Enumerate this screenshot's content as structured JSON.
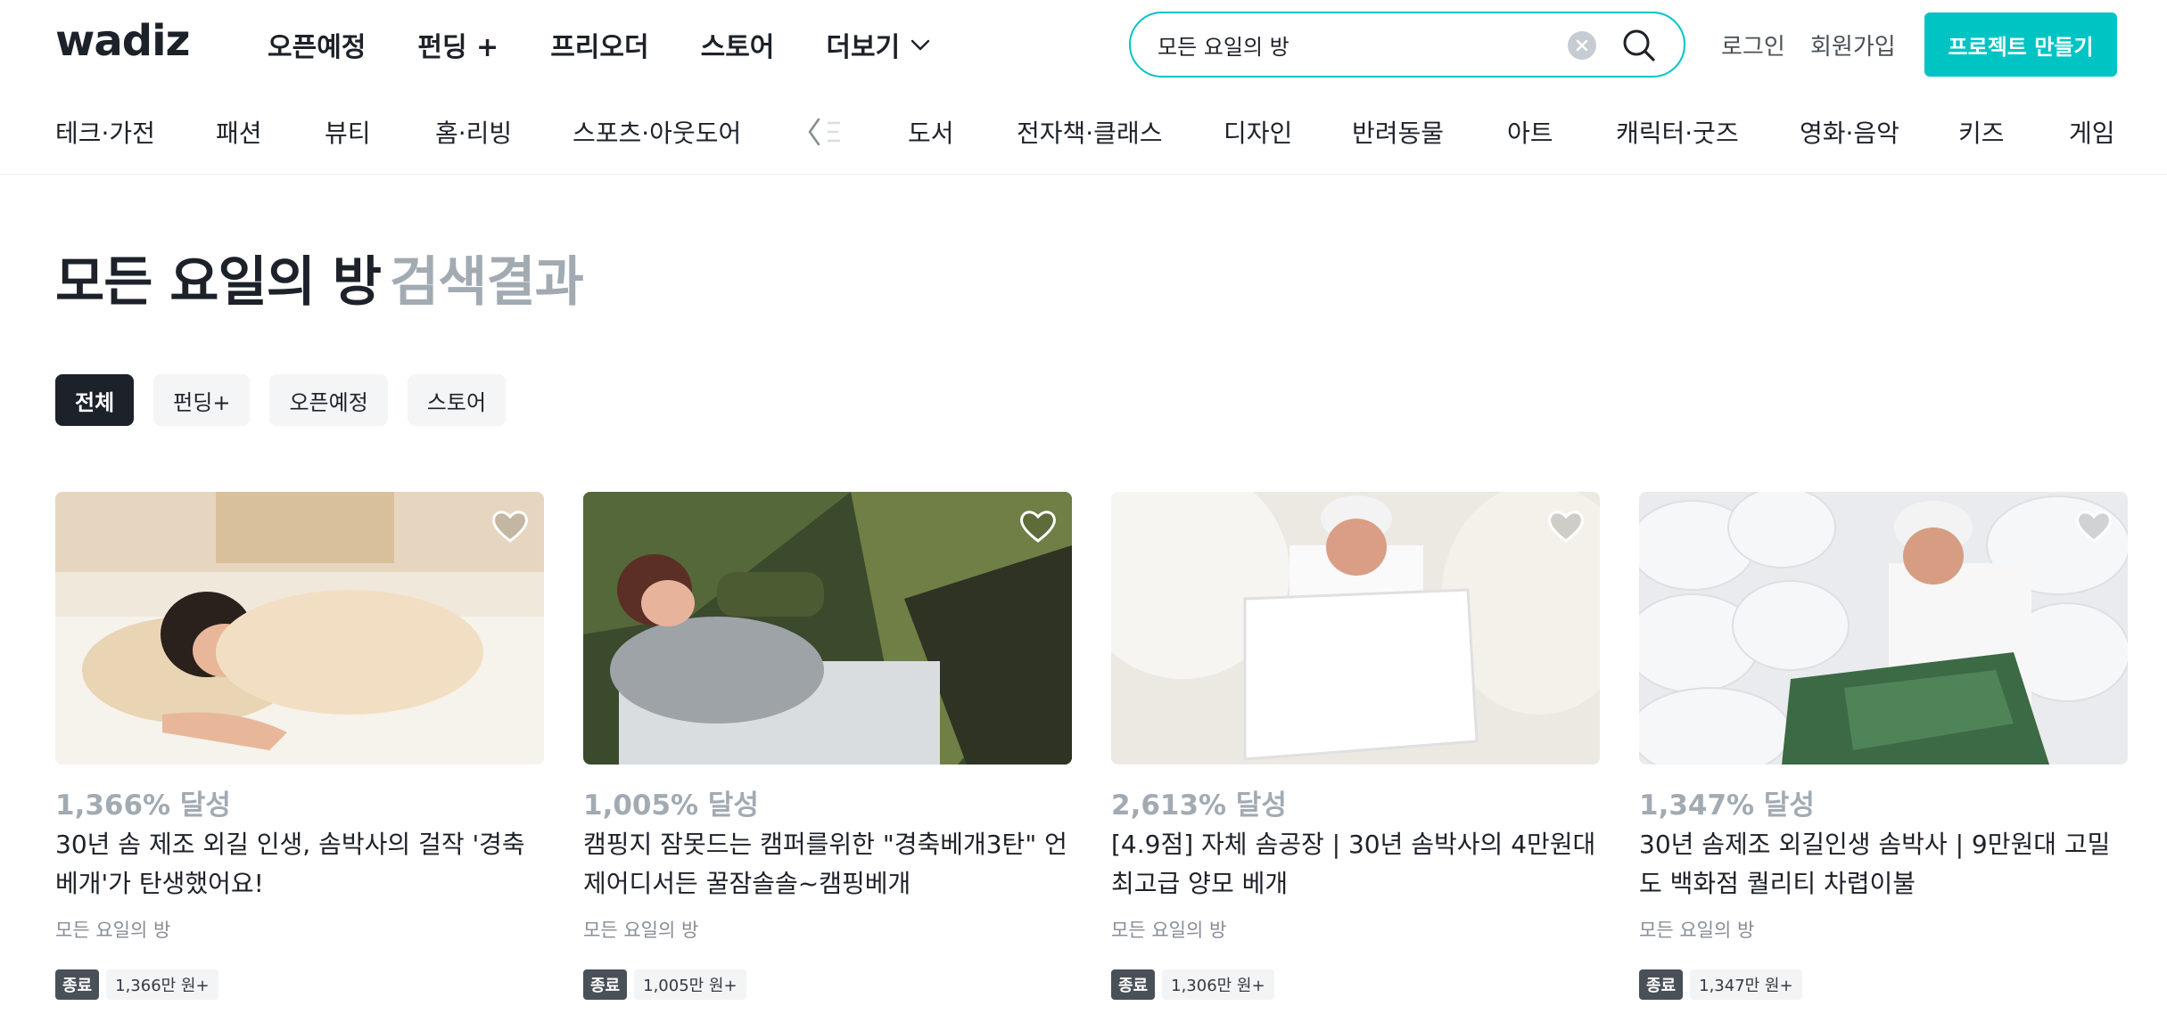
{
  "header": {
    "logo": "wadiz",
    "nav": [
      "오픈예정",
      "펀딩 +",
      "프리오더",
      "스토어",
      "더보기"
    ],
    "search": {
      "value": "모든 요일의 방"
    },
    "login": "로그인",
    "signup": "회원가입",
    "make_project": "프로젝트 만들기"
  },
  "categories": {
    "left": [
      "테크·가전",
      "패션",
      "뷰티",
      "홈·리빙",
      "스포츠·아웃도어"
    ],
    "scroll_label": "<",
    "right": [
      "도서",
      "전자책·클래스",
      "디자인",
      "반려동물",
      "아트",
      "캐릭터·굿즈",
      "영화·음악",
      "키즈",
      "게임"
    ]
  },
  "title": {
    "keyword": "모든 요일의 방",
    "suffix": "검색결과"
  },
  "filters": [
    "전체",
    "펀딩+",
    "오픈예정",
    "스토어"
  ],
  "cards": [
    {
      "rate": "1,366% 달성",
      "title": "30년 솜 제조 외길 인생, 솜박사의 걸작 '경축베개'가 탄생했어요!",
      "maker": "모든 요일의 방",
      "status": "종료",
      "amount": "1,366만 원+"
    },
    {
      "rate": "1,005% 달성",
      "title": "캠핑지 잠못드는 캠퍼를위한 \"경축베개3탄\" 언제어디서든 꿀잠솔솔~캠핑베개",
      "maker": "모든 요일의 방",
      "status": "종료",
      "amount": "1,005만 원+"
    },
    {
      "rate": "2,613% 달성",
      "title": "[4.9점] 자체 솜공장 | 30년 솜박사의 4만원대 최고급 양모 베개",
      "maker": "모든 요일의 방",
      "status": "종료",
      "amount": "1,306만 원+"
    },
    {
      "rate": "1,347% 달성",
      "title": "30년 솜제조 외길인생 솜박사 | 9만원대 고밀도 백화점 퀄리티 차렵이불",
      "maker": "모든 요일의 방",
      "status": "종료",
      "amount": "1,347만 원+"
    }
  ],
  "colors": {
    "accent": "#00c4c4",
    "text": "#1d2129",
    "muted": "#a2aab2"
  }
}
